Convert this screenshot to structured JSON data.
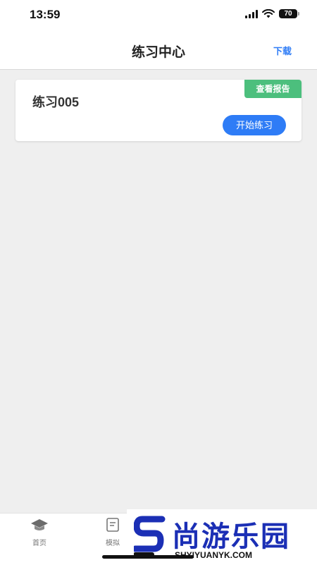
{
  "status": {
    "time": "13:59",
    "battery": "70"
  },
  "header": {
    "title": "练习中心",
    "action": "下载"
  },
  "practice": {
    "title": "练习005",
    "report_label": "查看报告",
    "start_label": "开始练习"
  },
  "tabs": [
    {
      "label": "首页",
      "icon": "graduation-cap-icon"
    },
    {
      "label": "模拟",
      "icon": "exam-paper-icon"
    }
  ],
  "watermark": {
    "brand": "尚游乐园",
    "url": "SHYIYUANYK.COM"
  },
  "colors": {
    "accent_blue": "#2e7cf6",
    "report_green": "#4cbf7d",
    "background": "#efefef"
  }
}
